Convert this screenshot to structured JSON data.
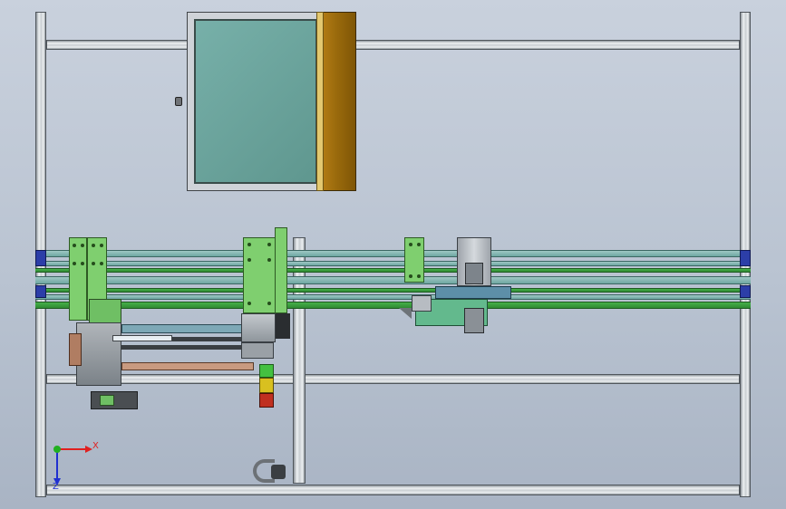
{
  "viewport": {
    "background_top": "#c9d1dd",
    "background_bottom": "#a9b4c4"
  },
  "triad": {
    "x_label": "X",
    "z_label": "Z",
    "x_color": "#e02020",
    "y_color": "#20b020",
    "z_color": "#2030d0"
  },
  "colors": {
    "cabinet_panel": "#6aa39c",
    "cabinet_door": "#9a6a0c",
    "plate_green": "#7fcf6f",
    "rail_green": "#46b049",
    "rail_teal": "#9fc8c4",
    "rail_end_blue": "#2c3ea8",
    "bracket_copper": "#c89a80",
    "tower_light_green": "#44c040",
    "tower_light_yellow": "#d8c020",
    "tower_light_red": "#c03020",
    "carriage_steel": "#b8bcc4"
  },
  "icons": {
    "triad": "coordinate-triad-icon",
    "handle": "cabinet-handle-icon"
  }
}
